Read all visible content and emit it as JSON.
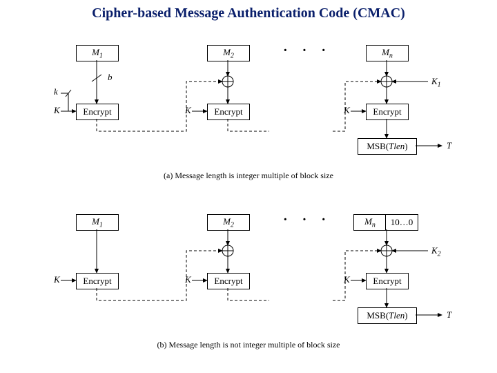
{
  "title": "Cipher-based Message Authentication Code (CMAC)",
  "labels": {
    "M1": "M",
    "M1sub": "1",
    "M2": "M",
    "M2sub": "2",
    "Mn": "M",
    "Mnsub": "n",
    "Encrypt": "Encrypt",
    "K": "K",
    "K1": "K",
    "K1sub": "1",
    "K2": "K",
    "K2sub": "2",
    "b": "b",
    "k": "k",
    "T": "T",
    "pad": "10…0",
    "MSB_pre": "MSB(",
    "MSB_arg": "Tlen",
    "MSB_post": ")"
  },
  "captions": {
    "a": "(a) Message length is integer multiple of block size",
    "b": "(b) Message length is not integer multiple of block size"
  },
  "dots": "· · ·"
}
